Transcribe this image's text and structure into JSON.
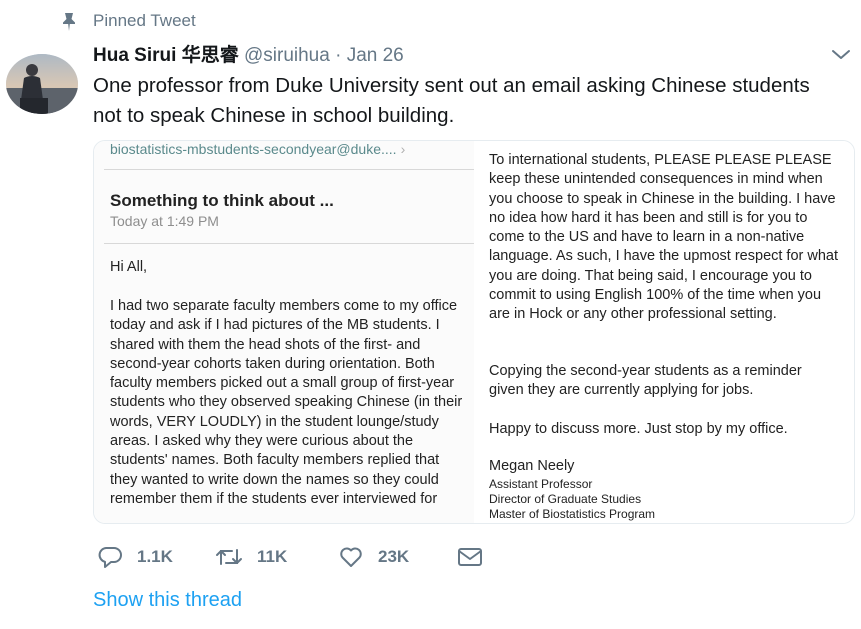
{
  "pinned": {
    "label": "Pinned Tweet",
    "icon": "pin-icon"
  },
  "author": {
    "name": "Hua Sirui",
    "name_cn": "华思睿",
    "handle": "@siruihua",
    "separator": "·",
    "date": "Jan 26"
  },
  "tweet": {
    "text": "One professor from Duke University sent out an email asking Chinese students not to speak Chinese in school building."
  },
  "email": {
    "to": "biostatistics-mbstudents-secondyear@duke....",
    "subject": "Something to think about ...",
    "time": "Today at 1:49 PM",
    "greeting": "Hi All,",
    "body": "I had two separate faculty members come to my office today and ask if I had pictures of the MB students. I shared with them the head shots of the first- and second-year cohorts taken during orientation. Both faculty members picked out a small group of first-year students who they observed speaking Chinese (in their words, VERY LOUDLY) in the student lounge/study areas. I asked why they were curious about the students' names. Both faculty members replied that they wanted to write down the names so they could remember them if the students ever interviewed for",
    "right_p1": "To international students, PLEASE PLEASE PLEASE keep these unintended consequences in mind when you choose to speak in Chinese in the building. I have no idea how hard it has been and still is for you to come to the US and have to learn in a non-native language. As such, I have the upmost respect for what you are doing. That being said, I encourage you to commit to using English 100% of the time when you are in Hock or any other professional setting.",
    "right_p2": "Copying the second-year students as a reminder given they are currently applying for jobs.",
    "right_p3": "Happy to discuss more. Just stop by my office.",
    "signature": {
      "name": "Megan Neely",
      "title1": "Assistant Professor",
      "title2": "Director of Graduate Studies",
      "title3": "Master of Biostatistics Program"
    }
  },
  "actions": {
    "reply_count": "1.1K",
    "retweet_count": "11K",
    "like_count": "23K"
  },
  "show_thread": "Show this thread",
  "colors": {
    "accent": "#1da1f2",
    "muted": "#657786",
    "text": "#14171a",
    "email_to": "#5b8a8c"
  }
}
